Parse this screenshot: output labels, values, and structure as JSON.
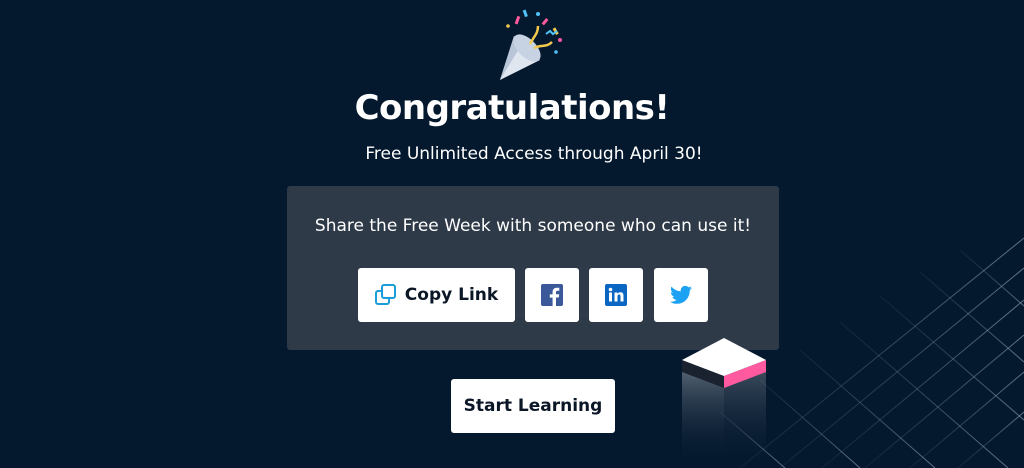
{
  "dialog": {
    "title": "Congratulations!",
    "subtitle": "Free Unlimited Access through April 30!"
  },
  "share": {
    "prompt": "Share the Free Week with someone who can use it!",
    "copy_link_label": "Copy Link",
    "icons": [
      "copy-link-icon",
      "facebook-icon",
      "linkedin-icon",
      "twitter-icon"
    ]
  },
  "actions": {
    "start_label": "Start Learning"
  },
  "colors": {
    "background": "#04182e",
    "card": "#2f3a48",
    "facebook": "#3b5998",
    "linkedin": "#0a66c2",
    "twitter": "#1da1f2",
    "copy_icon": "#1b9dd9",
    "accent_pink": "#ff5aa0"
  }
}
